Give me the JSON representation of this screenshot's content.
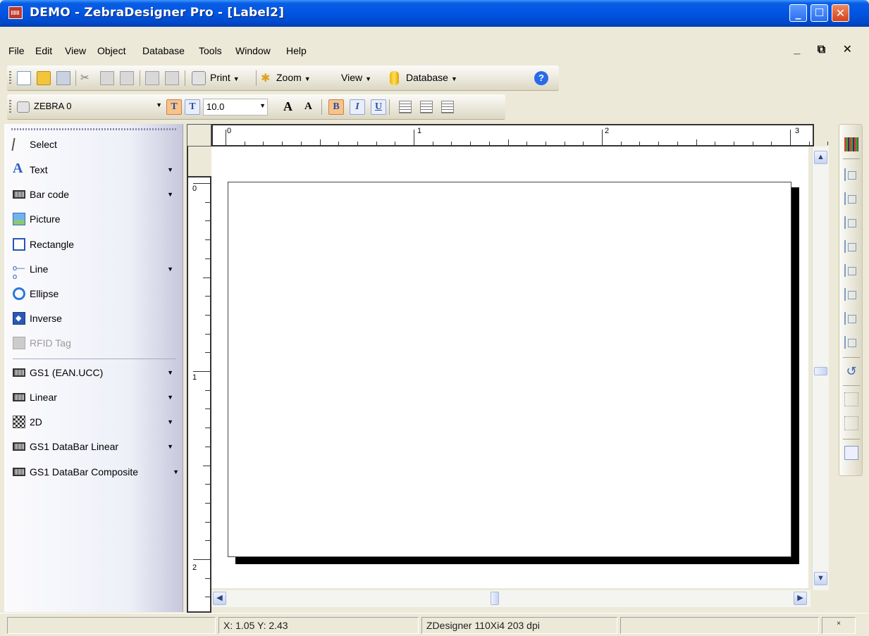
{
  "window": {
    "title": "DEMO - ZebraDesigner Pro - [Label2]"
  },
  "menu": [
    "File",
    "Edit",
    "View",
    "Object",
    "Database",
    "Tools",
    "Window",
    "Help"
  ],
  "toolbar_main": {
    "print_label": "Print",
    "zoom_label": "Zoom",
    "view_label": "View",
    "database_label": "Database"
  },
  "toolbar_format": {
    "printer": "ZEBRA 0",
    "font_size": "10.0"
  },
  "tools": [
    {
      "label": "Select",
      "icon": "pointer-icon",
      "dropdown": false,
      "enabled": true
    },
    {
      "label": "Text",
      "icon": "text-icon",
      "dropdown": true,
      "enabled": true
    },
    {
      "label": "Bar code",
      "icon": "barcode-icon",
      "dropdown": true,
      "enabled": true
    },
    {
      "label": "Picture",
      "icon": "picture-icon",
      "dropdown": false,
      "enabled": true
    },
    {
      "label": "Rectangle",
      "icon": "rectangle-icon",
      "dropdown": false,
      "enabled": true
    },
    {
      "label": "Line",
      "icon": "line-icon",
      "dropdown": true,
      "enabled": true
    },
    {
      "label": "Ellipse",
      "icon": "ellipse-icon",
      "dropdown": false,
      "enabled": true
    },
    {
      "label": "Inverse",
      "icon": "inverse-icon",
      "dropdown": false,
      "enabled": true
    },
    {
      "label": "RFID Tag",
      "icon": "rfid-icon",
      "dropdown": true,
      "enabled": false
    }
  ],
  "barcode_groups": [
    {
      "label": "GS1 (EAN.UCC)",
      "icon": "barcode-icon"
    },
    {
      "label": "Linear",
      "icon": "barcode-icon"
    },
    {
      "label": "2D",
      "icon": "2d-barcode-icon"
    },
    {
      "label": "GS1 DataBar Linear",
      "icon": "barcode-icon"
    },
    {
      "label": "GS1 DataBar Composite",
      "icon": "barcode-icon"
    }
  ],
  "ruler": {
    "h_numbers": [
      "0",
      "1",
      "2",
      "3"
    ],
    "v_numbers": [
      "0",
      "1",
      "2"
    ]
  },
  "status": {
    "coordinates": "X: 1.05 Y: 2.43",
    "printer": "ZDesigner 110Xi4 203 dpi"
  }
}
